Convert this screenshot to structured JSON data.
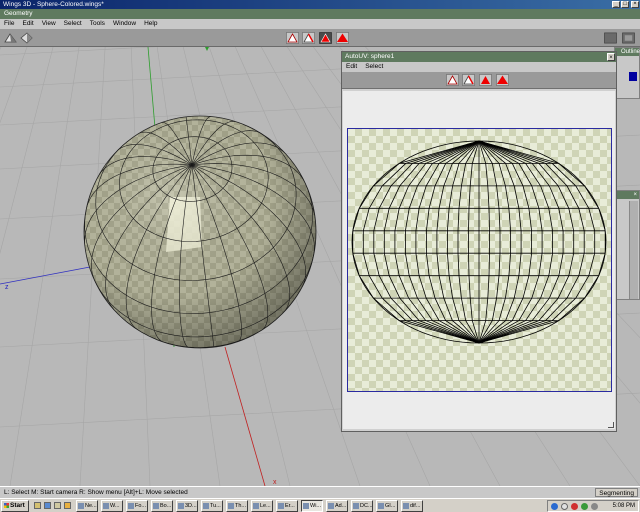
{
  "window": {
    "title": "Wings 3D - Sphere-Colored.wings*",
    "min_glyph": "_",
    "max_glyph": "□",
    "close_glyph": "×"
  },
  "geometry_bar": {
    "label": "Geometry"
  },
  "menu": [
    "File",
    "Edit",
    "View",
    "Select",
    "Tools",
    "Window",
    "Help"
  ],
  "side_panels": {
    "outliner_title": "Outliner",
    "close_glyph": "×"
  },
  "axes": {
    "z_label": "z",
    "x_label": "x"
  },
  "autouv": {
    "title": "AutoUV: sphere1",
    "menu": [
      "Edit",
      "Select"
    ],
    "close_glyph": "×"
  },
  "status": {
    "hint": "L: Select   M: Start camera   R: Show menu   [Alt]+L: Move selected",
    "mode": "Segmenting"
  },
  "taskbar": {
    "start": "Start",
    "tasks": [
      "Ne...",
      "W...",
      "Fo...",
      "Bo...",
      "3D...",
      "Tu...",
      "Th...",
      "Le...",
      "Er...",
      "Wi...",
      "Ad...",
      "DC...",
      "GI...",
      "dif..."
    ],
    "active_index": 9,
    "clock": "5:08 PM"
  },
  "colors": {
    "accent": "#5f7a5f",
    "selection_red": "#e00000",
    "uv_border": "#2a2aa0"
  }
}
